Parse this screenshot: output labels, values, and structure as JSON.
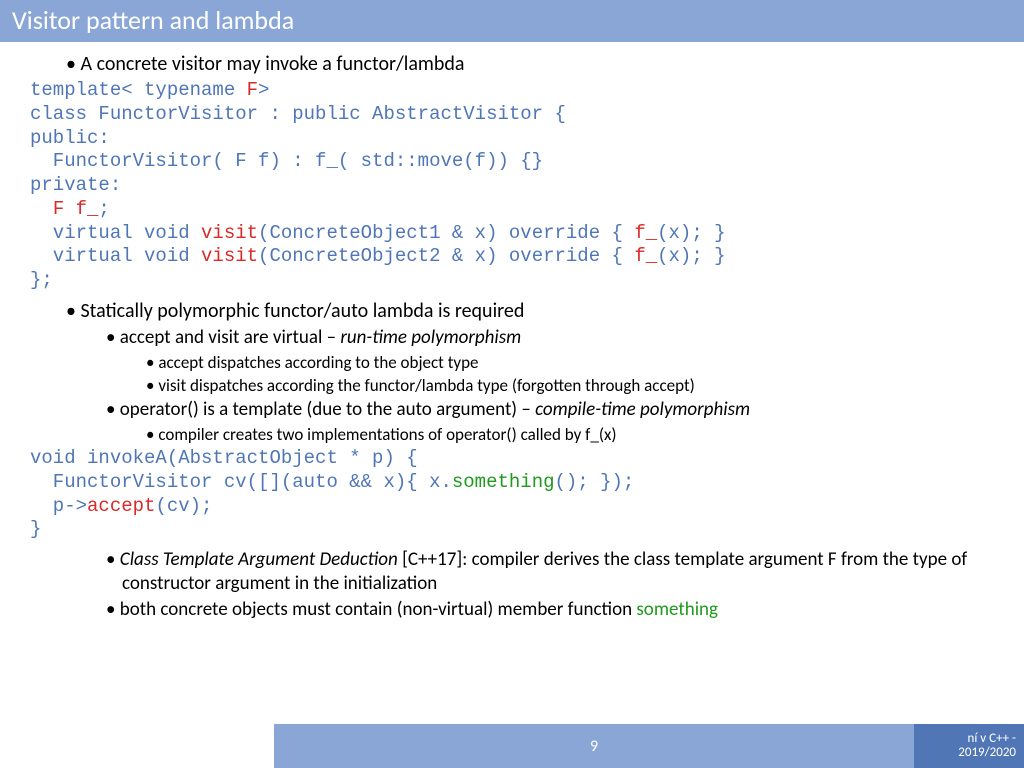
{
  "title": "Visitor pattern and lambda",
  "bullets": {
    "b1": "A concrete visitor may invoke a functor/lambda",
    "b2": "Statically polymorphic functor/auto lambda is required",
    "b2a_pre": "accept and visit are virtual – ",
    "b2a_em": "run-time polymorphism",
    "b2a1": "accept dispatches according to the object type",
    "b2a2": "visit dispatches according the functor/lambda type (forgotten through accept)",
    "b2b_pre": "operator() is a template (due to the auto argument) – ",
    "b2b_em": "compile-time polymorphism",
    "b2b1": "compiler creates two implementations of operator() called by f_(x)",
    "b3a_em": "Class Template Argument Deduction",
    "b3a_post": " [C++17]: compiler derives the class template argument F from the type of constructor argument in the initialization",
    "b3b_pre": "both concrete objects must contain (non-virtual) member function ",
    "b3b_green": "something"
  },
  "code1": {
    "l1a": "template< typename ",
    "l1b": "F",
    "l1c": ">",
    "l2": "class FunctorVisitor : public AbstractVisitor {",
    "l3": "public:",
    "l4": "  FunctorVisitor( F f) : f_( std::move(f)) {}",
    "l5": "private:",
    "l6a": "  ",
    "l6b": "F f_",
    "l6c": ";",
    "l7a": "  virtual void ",
    "l7b": "visit",
    "l7c": "(ConcreteObject1 & x) override { ",
    "l7d": "f_",
    "l7e": "(x); }",
    "l8a": "  virtual void ",
    "l8b": "visit",
    "l8c": "(ConcreteObject2 & x) override { ",
    "l8d": "f_",
    "l8e": "(x); }",
    "l9": "};"
  },
  "code2": {
    "l1": "void invokeA(AbstractObject * p) {",
    "l2a": "  FunctorVisitor cv([](auto && x){ x.",
    "l2b": "something",
    "l2c": "(); });",
    "l3a": "  p->",
    "l3b": "accept",
    "l3c": "(cv);",
    "l4": "}"
  },
  "footer": {
    "page": "9",
    "course1": "ní v C++ -",
    "course2": "2019/2020"
  }
}
